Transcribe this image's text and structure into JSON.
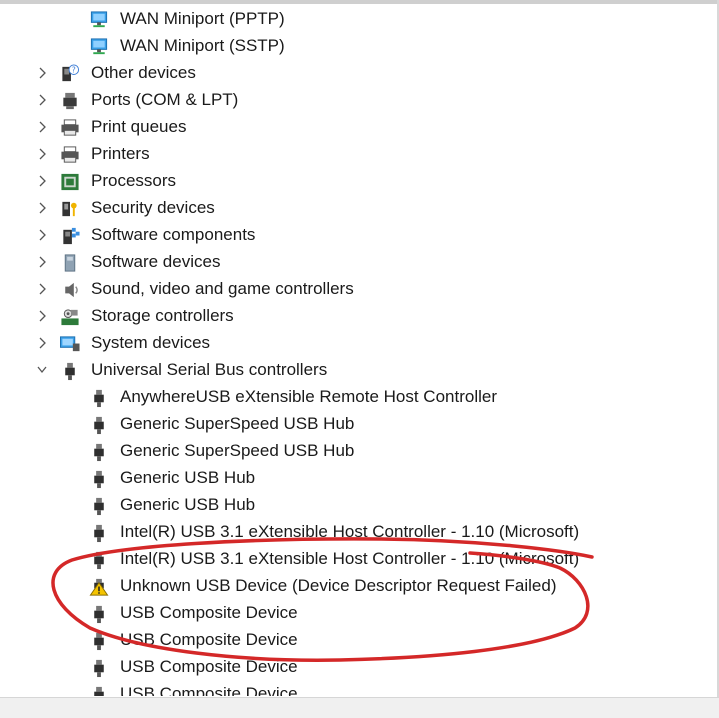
{
  "tree": {
    "items": [
      {
        "label": "WAN Miniport (PPTP)",
        "icon": "network-adapter-icon",
        "level": 1,
        "expander": "none"
      },
      {
        "label": "WAN Miniport (SSTP)",
        "icon": "network-adapter-icon",
        "level": 1,
        "expander": "none"
      },
      {
        "label": "Other devices",
        "icon": "unknown-device-icon",
        "level": 0,
        "expander": "collapsed"
      },
      {
        "label": "Ports (COM & LPT)",
        "icon": "port-icon",
        "level": 0,
        "expander": "collapsed"
      },
      {
        "label": "Print queues",
        "icon": "printer-icon",
        "level": 0,
        "expander": "collapsed"
      },
      {
        "label": "Printers",
        "icon": "printer-icon",
        "level": 0,
        "expander": "collapsed"
      },
      {
        "label": "Processors",
        "icon": "processor-icon",
        "level": 0,
        "expander": "collapsed"
      },
      {
        "label": "Security devices",
        "icon": "security-key-icon",
        "level": 0,
        "expander": "collapsed"
      },
      {
        "label": "Software components",
        "icon": "software-component-icon",
        "level": 0,
        "expander": "collapsed"
      },
      {
        "label": "Software devices",
        "icon": "software-device-icon",
        "level": 0,
        "expander": "collapsed"
      },
      {
        "label": "Sound, video and game controllers",
        "icon": "speaker-icon",
        "level": 0,
        "expander": "collapsed"
      },
      {
        "label": "Storage controllers",
        "icon": "storage-controller-icon",
        "level": 0,
        "expander": "collapsed"
      },
      {
        "label": "System devices",
        "icon": "system-device-icon",
        "level": 0,
        "expander": "collapsed"
      },
      {
        "label": "Universal Serial Bus controllers",
        "icon": "usb-plug-icon",
        "level": 0,
        "expander": "expanded"
      },
      {
        "label": "AnywhereUSB eXtensible Remote Host Controller",
        "icon": "usb-plug-icon",
        "level": 1,
        "expander": "none"
      },
      {
        "label": "Generic SuperSpeed USB Hub",
        "icon": "usb-plug-icon",
        "level": 1,
        "expander": "none"
      },
      {
        "label": "Generic SuperSpeed USB Hub",
        "icon": "usb-plug-icon",
        "level": 1,
        "expander": "none"
      },
      {
        "label": "Generic USB Hub",
        "icon": "usb-plug-icon",
        "level": 1,
        "expander": "none"
      },
      {
        "label": "Generic USB Hub",
        "icon": "usb-plug-icon",
        "level": 1,
        "expander": "none"
      },
      {
        "label": "Intel(R) USB 3.1 eXtensible Host Controller - 1.10 (Microsoft)",
        "icon": "usb-plug-icon",
        "level": 1,
        "expander": "none"
      },
      {
        "label": "Intel(R) USB 3.1 eXtensible Host Controller - 1.10 (Microsoft)",
        "icon": "usb-plug-icon",
        "level": 1,
        "expander": "none"
      },
      {
        "label": "Unknown USB Device (Device Descriptor Request Failed)",
        "icon": "warning-icon",
        "level": 1,
        "expander": "none"
      },
      {
        "label": "USB Composite Device",
        "icon": "usb-plug-icon",
        "level": 1,
        "expander": "none"
      },
      {
        "label": "USB Composite Device",
        "icon": "usb-plug-icon",
        "level": 1,
        "expander": "none"
      },
      {
        "label": "USB Composite Device",
        "icon": "usb-plug-icon",
        "level": 1,
        "expander": "none"
      },
      {
        "label": "USB Composite Device",
        "icon": "usb-plug-icon",
        "level": 1,
        "expander": "none"
      }
    ]
  },
  "colors": {
    "annotation": "#d42828",
    "warning": "#f5c400",
    "chevron": "#555555"
  }
}
